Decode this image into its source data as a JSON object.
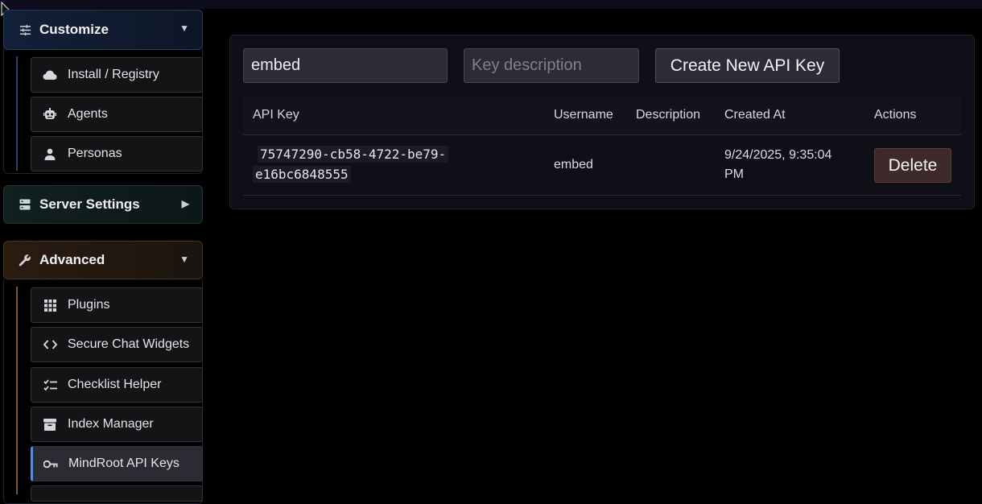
{
  "sidebar": {
    "sections": [
      {
        "label": "Customize",
        "icon": "sliders-icon",
        "expanded": true
      },
      {
        "label": "Server Settings",
        "icon": "server-icon",
        "expanded": false
      },
      {
        "label": "Advanced",
        "icon": "wrench-icon",
        "expanded": true
      }
    ],
    "customize_items": [
      {
        "label": "Install / Registry",
        "icon": "cloud-icon"
      },
      {
        "label": "Agents",
        "icon": "robot-icon"
      },
      {
        "label": "Personas",
        "icon": "person-icon"
      }
    ],
    "advanced_items": [
      {
        "label": "Plugins",
        "icon": "grid-icon"
      },
      {
        "label": "Secure Chat Widgets",
        "icon": "code-icon"
      },
      {
        "label": "Checklist Helper",
        "icon": "checklist-icon"
      },
      {
        "label": "Index Manager",
        "icon": "archive-icon"
      },
      {
        "label": "MindRoot API Keys",
        "icon": "key-icon",
        "active": true
      }
    ]
  },
  "form": {
    "username_value": "embed",
    "description_placeholder": "Key description",
    "create_label": "Create New API Key"
  },
  "table": {
    "headers": [
      "API Key",
      "Username",
      "Description",
      "Created At",
      "Actions"
    ],
    "rows": [
      {
        "api_key_line1": "75747290-cb58-4722-be79-",
        "api_key_line2": "e16bc6848555",
        "username": "embed",
        "description": "",
        "created_line1": "9/24/2025, 9:35:04",
        "created_line2": "PM",
        "action_label": "Delete"
      }
    ]
  },
  "colors": {
    "background": "#000000",
    "panel": "#0f0f17",
    "customize_accent": "#2d3e6a",
    "advanced_accent": "#7a5530",
    "active_indicator": "#4f8fe8",
    "delete_button": "#3e2a2a"
  }
}
